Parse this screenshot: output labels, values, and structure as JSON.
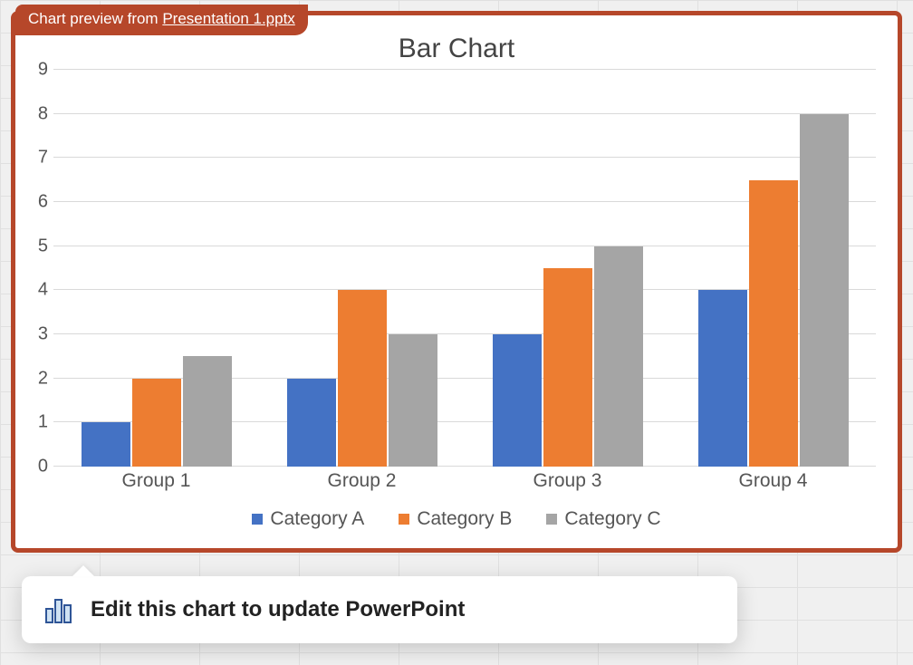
{
  "preview": {
    "prefix": "Chart preview from ",
    "filename": "Presentation 1.pptx"
  },
  "callout": {
    "text": "Edit this chart to update PowerPoint"
  },
  "chart_data": {
    "type": "bar",
    "title": "Bar Chart",
    "categories": [
      "Group 1",
      "Group 2",
      "Group 3",
      "Group 4"
    ],
    "series": [
      {
        "name": "Category A",
        "color": "#4472C4",
        "values": [
          1,
          2,
          3,
          4
        ]
      },
      {
        "name": "Category B",
        "color": "#ED7D31",
        "values": [
          2,
          4,
          4.5,
          6.5
        ]
      },
      {
        "name": "Category C",
        "color": "#A5A5A5",
        "values": [
          2.5,
          3,
          5,
          8
        ]
      }
    ],
    "xlabel": "",
    "ylabel": "",
    "ylim": [
      0,
      9
    ],
    "yticks": [
      0,
      1,
      2,
      3,
      4,
      5,
      6,
      7,
      8,
      9
    ]
  }
}
